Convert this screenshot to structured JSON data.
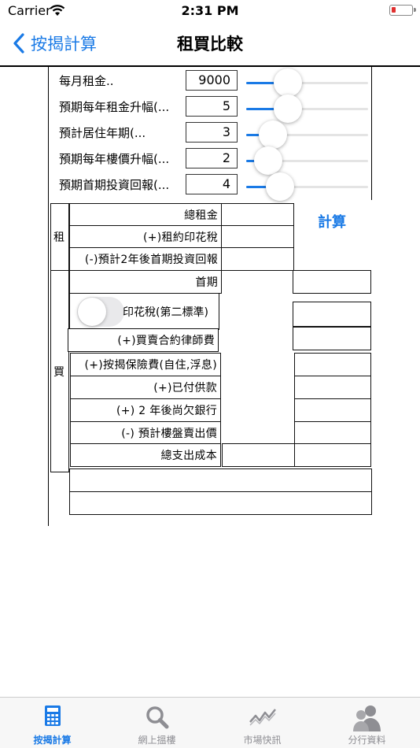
{
  "status_bar": {
    "carrier": "Carrier",
    "time": "2:31 PM"
  },
  "nav": {
    "back_label": "按揭計算",
    "title": "租買比較"
  },
  "inputs": [
    {
      "label": "每月租金..",
      "value": "9000",
      "slider_fraction": 0.34
    },
    {
      "label": "預期每年租金升幅(...",
      "value": "5",
      "slider_fraction": 0.34
    },
    {
      "label": "預計居住年期(...",
      "value": "3",
      "slider_fraction": 0.22
    },
    {
      "label": "預期每年樓價升幅(...",
      "value": "2",
      "slider_fraction": 0.18
    },
    {
      "label": "預期首期投資回報(...",
      "value": "4",
      "slider_fraction": 0.28
    }
  ],
  "calc_button": "計算",
  "rent_section": {
    "side_label": "租",
    "rows": [
      "總租金",
      "(+)租約印花稅",
      "(-)預計2年後首期投資回報"
    ]
  },
  "buy_section": {
    "side_label": "買",
    "down_payment": "首期",
    "stamp_duty": "印花稅(第二標準)",
    "stamp_toggle_on": false,
    "legal_fee": "(+)買賣合約律師費",
    "rows": [
      "(+)按揭保險費(自住,浮息)",
      "(+)已付供款",
      "(+) 2 年後尚欠銀行",
      "(-) 預計樓盤賣出價",
      "總支出成本"
    ]
  },
  "tabs": [
    {
      "label": "按揭計算",
      "icon": "calculator-icon",
      "active": true
    },
    {
      "label": "網上搵樓",
      "icon": "magnifier-icon",
      "active": false
    },
    {
      "label": "市場快訊",
      "icon": "trend-chart-icon",
      "active": false
    },
    {
      "label": "分行資料",
      "icon": "people-icon",
      "active": false
    }
  ],
  "colors": {
    "accent": "#1a7ae6",
    "inactive_tab": "#8e8e93"
  }
}
